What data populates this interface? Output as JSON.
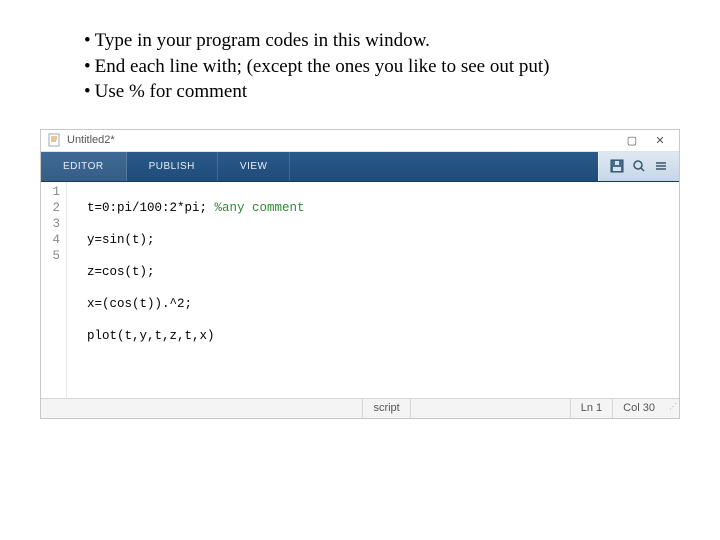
{
  "instructions": {
    "items": [
      "Type in your program codes in this window.",
      "End each line with; (except the ones you like to see out put)",
      "Use % for comment"
    ]
  },
  "window": {
    "title": "Untitled2*",
    "maximize_glyph": "▢",
    "close_glyph": "✕"
  },
  "tabs": {
    "editor": "EDITOR",
    "publish": "PUBLISH",
    "view": "VIEW"
  },
  "tool_icons": {
    "save": "save-icon",
    "search": "search-icon",
    "menu": "menu-icon"
  },
  "code": {
    "gutter": [
      "1",
      "2",
      "3",
      "4",
      "5"
    ],
    "lines": [
      {
        "text": "t=0:pi/100:2*pi; ",
        "comment": "%any comment"
      },
      {
        "text": "y=sin(t);"
      },
      {
        "text": "z=cos(t);"
      },
      {
        "text": "x=(cos(t)).^2;"
      },
      {
        "text": "plot(t,y,t,z,t,x)"
      }
    ]
  },
  "status": {
    "type": "script",
    "ln_label": "Ln",
    "ln_value": "1",
    "col_label": "Col",
    "col_value": "30"
  }
}
